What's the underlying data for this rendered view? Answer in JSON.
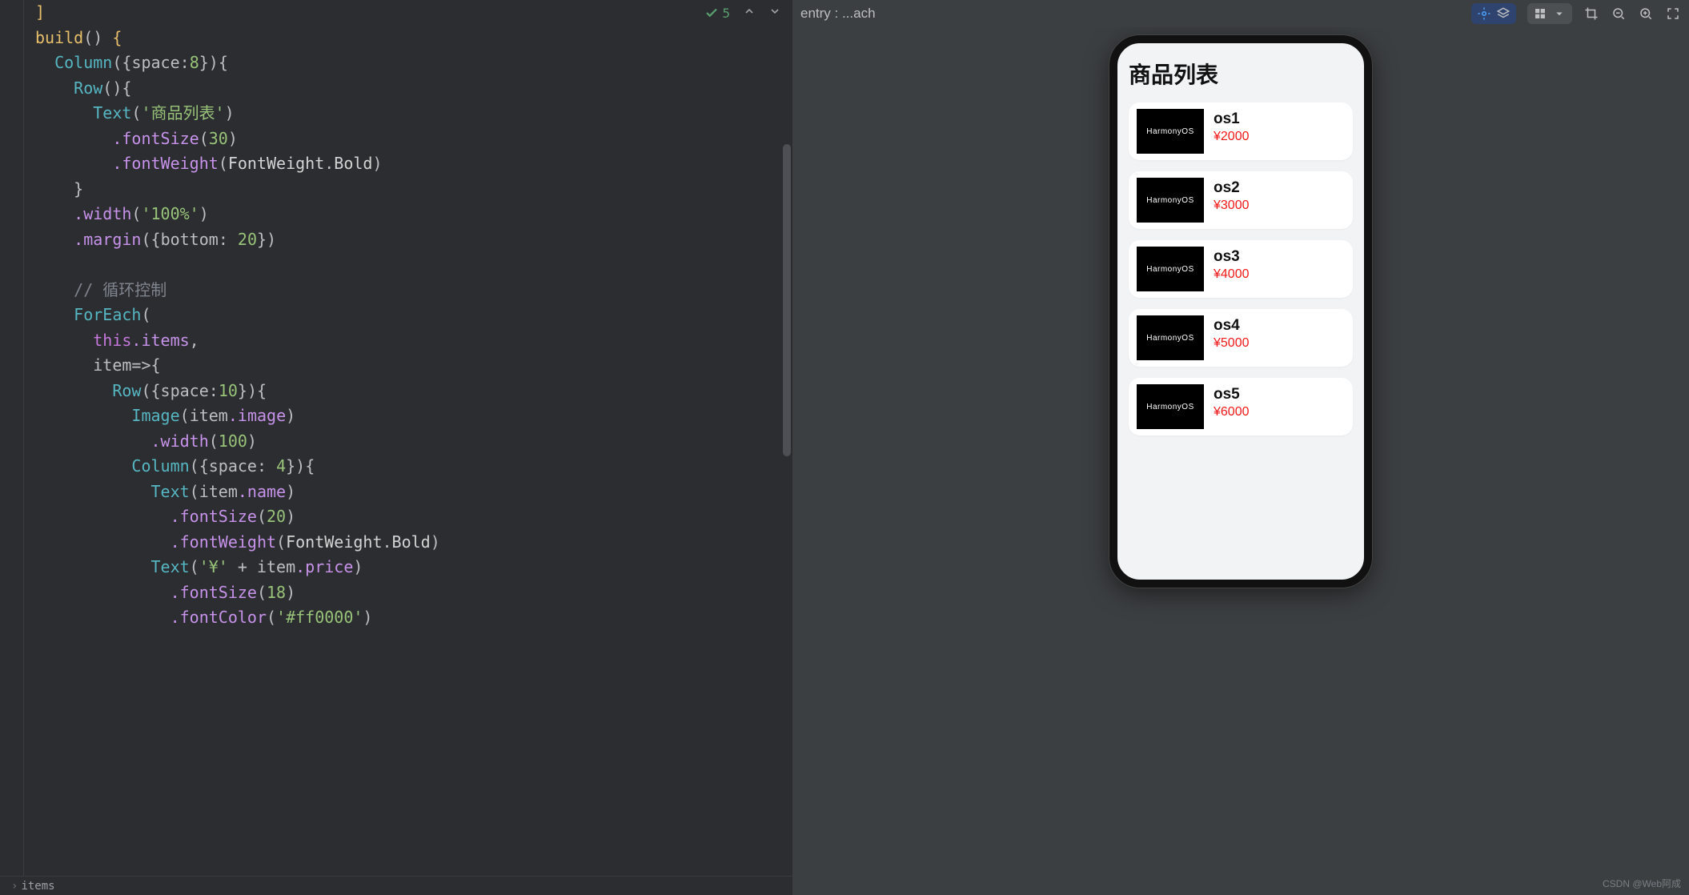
{
  "editor": {
    "inspection": {
      "count": "5"
    },
    "code": {
      "l1": "]",
      "l2_build": "build",
      "l3_Column": "Column",
      "l3_space": "space",
      "l3_8": "8",
      "l4_Row": "Row",
      "l5_Text": "Text",
      "l5_str": "'商品列表'",
      "l6_fontSize": ".fontSize",
      "l6_30": "30",
      "l7_fontWeight": ".fontWeight",
      "l7_FW": "FontWeight",
      "l7_Bold": "Bold",
      "l9_width": ".width",
      "l9_str": "'100%'",
      "l10_margin": ".margin",
      "l10_bottom": "bottom",
      "l10_20": "20",
      "l12_comment": "// 循环控制",
      "l13_ForEach": "ForEach",
      "l14_this": "this",
      "l14_items": ".items",
      "l15_item": "item",
      "l16_Row": "Row",
      "l16_space": "space",
      "l16_10": "10",
      "l17_Image": "Image",
      "l17_item": "item",
      "l17_image": ".image",
      "l18_width": ".width",
      "l18_100": "100",
      "l19_Column": "Column",
      "l19_space": "space",
      "l19_4": "4",
      "l20_Text": "Text",
      "l20_item": "item",
      "l20_name": ".name",
      "l21_fontSize": ".fontSize",
      "l21_20": "20",
      "l22_fontWeight": ".fontWeight",
      "l22_FW": "FontWeight",
      "l22_Bold": "Bold",
      "l23_Text": "Text",
      "l23_str": "'¥'",
      "l23_plus": " + ",
      "l23_item": "item",
      "l23_price": ".price",
      "l24_fontSize": ".fontSize",
      "l24_18": "18",
      "l25_fontColor": ".fontColor",
      "l25_str": "'#ff0000'"
    },
    "breadcrumb": {
      "item": "items"
    }
  },
  "preview": {
    "toolbar": {
      "title": "entry : ...ach"
    },
    "page_title": "商品列表",
    "thumb_label": "HarmonyOS",
    "currency": "¥",
    "items": [
      {
        "name": "os1",
        "price": "2000"
      },
      {
        "name": "os2",
        "price": "3000"
      },
      {
        "name": "os3",
        "price": "4000"
      },
      {
        "name": "os4",
        "price": "5000"
      },
      {
        "name": "os5",
        "price": "6000"
      }
    ]
  },
  "watermark": "CSDN @Web阿成"
}
